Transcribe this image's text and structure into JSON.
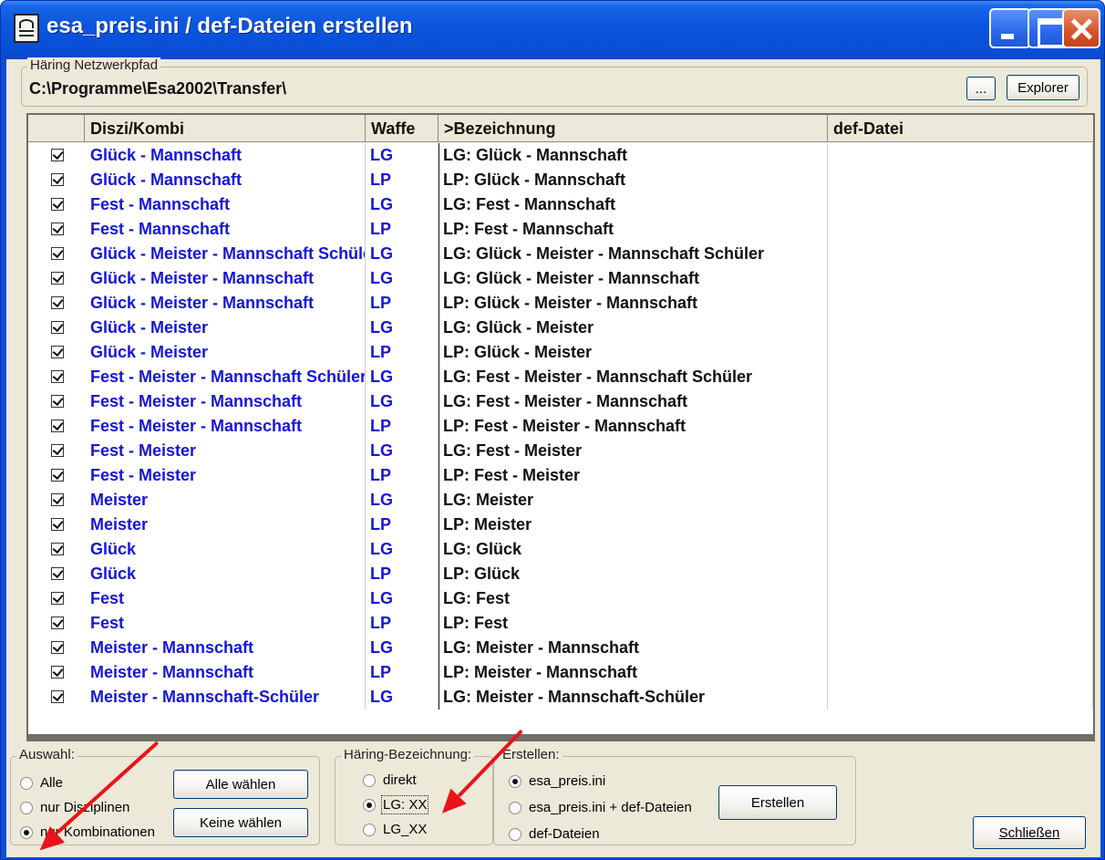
{
  "window": {
    "title": "esa_preis.ini / def-Dateien erstellen"
  },
  "network_path": {
    "label": "Häring Netzwerkpfad",
    "value": "C:\\Programme\\Esa2002\\Transfer\\",
    "browse_label": "...",
    "explorer_label": "Explorer"
  },
  "grid": {
    "headers": [
      "",
      "Diszi/Kombi",
      "Waffe",
      ">Bezeichnung",
      "def-Datei"
    ],
    "rows": [
      {
        "checked": true,
        "disc": "Glück - Mannschaft",
        "waffe": "LG",
        "bez": "LG: Glück - Mannschaft",
        "def": ""
      },
      {
        "checked": true,
        "disc": "Glück - Mannschaft",
        "waffe": "LP",
        "bez": "LP: Glück - Mannschaft",
        "def": ""
      },
      {
        "checked": true,
        "disc": "Fest - Mannschaft",
        "waffe": "LG",
        "bez": "LG: Fest - Mannschaft",
        "def": ""
      },
      {
        "checked": true,
        "disc": "Fest - Mannschaft",
        "waffe": "LP",
        "bez": "LP: Fest - Mannschaft",
        "def": ""
      },
      {
        "checked": true,
        "disc": "Glück - Meister - Mannschaft Schüler",
        "waffe": "LG",
        "bez": "LG: Glück - Meister - Mannschaft Schüler",
        "def": ""
      },
      {
        "checked": true,
        "disc": "Glück - Meister - Mannschaft",
        "waffe": "LG",
        "bez": "LG: Glück - Meister - Mannschaft",
        "def": ""
      },
      {
        "checked": true,
        "disc": "Glück - Meister - Mannschaft",
        "waffe": "LP",
        "bez": "LP: Glück - Meister - Mannschaft",
        "def": ""
      },
      {
        "checked": true,
        "disc": "Glück - Meister",
        "waffe": "LG",
        "bez": "LG: Glück - Meister",
        "def": ""
      },
      {
        "checked": true,
        "disc": "Glück - Meister",
        "waffe": "LP",
        "bez": "LP: Glück - Meister",
        "def": ""
      },
      {
        "checked": true,
        "disc": "Fest - Meister - Mannschaft Schüler",
        "waffe": "LG",
        "bez": "LG: Fest - Meister - Mannschaft Schüler",
        "def": ""
      },
      {
        "checked": true,
        "disc": "Fest - Meister - Mannschaft",
        "waffe": "LG",
        "bez": "LG: Fest - Meister - Mannschaft",
        "def": ""
      },
      {
        "checked": true,
        "disc": "Fest - Meister - Mannschaft",
        "waffe": "LP",
        "bez": "LP: Fest - Meister - Mannschaft",
        "def": ""
      },
      {
        "checked": true,
        "disc": "Fest - Meister",
        "waffe": "LG",
        "bez": "LG: Fest - Meister",
        "def": ""
      },
      {
        "checked": true,
        "disc": "Fest - Meister",
        "waffe": "LP",
        "bez": "LP: Fest - Meister",
        "def": ""
      },
      {
        "checked": true,
        "disc": "Meister",
        "waffe": "LG",
        "bez": "LG: Meister",
        "def": ""
      },
      {
        "checked": true,
        "disc": "Meister",
        "waffe": "LP",
        "bez": "LP: Meister",
        "def": ""
      },
      {
        "checked": true,
        "disc": "Glück",
        "waffe": "LG",
        "bez": "LG: Glück",
        "def": ""
      },
      {
        "checked": true,
        "disc": "Glück",
        "waffe": "LP",
        "bez": "LP: Glück",
        "def": ""
      },
      {
        "checked": true,
        "disc": "Fest",
        "waffe": "LG",
        "bez": "LG: Fest",
        "def": ""
      },
      {
        "checked": true,
        "disc": "Fest",
        "waffe": "LP",
        "bez": "LP: Fest",
        "def": ""
      },
      {
        "checked": true,
        "disc": "Meister - Mannschaft",
        "waffe": "LG",
        "bez": "LG: Meister - Mannschaft",
        "def": ""
      },
      {
        "checked": true,
        "disc": "Meister - Mannschaft",
        "waffe": "LP",
        "bez": "LP: Meister - Mannschaft",
        "def": ""
      },
      {
        "checked": true,
        "disc": "Meister - Mannschaft-Schüler",
        "waffe": "LG",
        "bez": "LG: Meister - Mannschaft-Schüler",
        "def": ""
      }
    ]
  },
  "auswahl": {
    "label": "Auswahl:",
    "options": [
      "Alle",
      "nur Disziplinen",
      "nur Kombinationen"
    ],
    "selected": 2,
    "all_button": "Alle wählen",
    "none_button": "Keine wählen"
  },
  "haering": {
    "label": "Häring-Bezeichnung:",
    "options": [
      "direkt",
      "LG: XX",
      "LG_XX"
    ],
    "selected": 1
  },
  "erstellen": {
    "label": "Erstellen:",
    "options": [
      "esa_preis.ini",
      "esa_preis.ini + def-Dateien",
      "def-Dateien"
    ],
    "selected": 0,
    "button": "Erstellen"
  },
  "close_button": "Schließen",
  "colors": {
    "titlebar": "#0a4ed6",
    "client": "#ece9d8",
    "grid_blue_text": "#1515d8",
    "annotation_arrow": "#e8141a"
  }
}
